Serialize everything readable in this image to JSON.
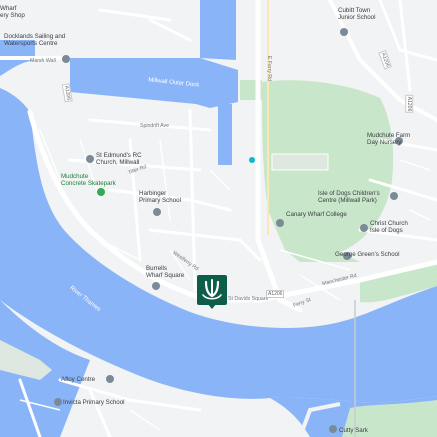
{
  "map": {
    "water_labels": {
      "outer_dock": "Millwall Outer Dock",
      "river": "River Thames"
    },
    "places": {
      "canary_wharf_top": "Wharf\nery Shop",
      "docklands_sailing": "Docklands Sailing and\nWatersports Centre",
      "cubitt_town": "Cubitt Town\nJunior School",
      "mudchute_farm": "Mudchute Farm\nDay Nursery",
      "st_edmunds": "St Edmund's RC\nChurch, Millwall",
      "mudchute_skatepark": "Mudchute\nConcrete Skatepark",
      "harbinger": "Harbinger\nPrimary School",
      "isle_of_dogs_childrens": "Isle of Dogs Children's\nCentre (Millwall Park)",
      "canary_wharf_college": "Canary Wharf College",
      "christ_church": "Christ Church\nIsle of Dogs",
      "george_greens": "George Green's School",
      "burrells_wharf": "Burrells\nWharf Square",
      "afloy_centre": "Afloy Centre",
      "invicta": "Invicta Primary School",
      "cutty_sark": "Cutty Sark"
    },
    "roads": {
      "westferry_rd": "Westferry Rd",
      "manchester_rd": "Manchester Rd",
      "ferry_st": "Ferry St",
      "st_davids_sq": "St Davids Square",
      "e_ferry_rd": "E Ferry Rd",
      "spindrift_ave": "Spindrift Ave",
      "tiller_rd": "Tiller Rd",
      "marsh_wall": "Marsh Wall"
    },
    "shields": {
      "a1206_top": "A1206",
      "a1206_right": "A1206",
      "a1206_bottom": "A1206",
      "a1206_left": "A1206"
    },
    "colors": {
      "water": "#8ab4f8",
      "land": "#f1f3f4",
      "park": "#c8e6c9",
      "park_dark": "#a8dab5",
      "road": "#ffffff",
      "marker": "#0e5c4a",
      "poi_grey": "#7b8a96",
      "poi_green": "#34a853"
    },
    "marker_icon": "company-logo-marker"
  }
}
